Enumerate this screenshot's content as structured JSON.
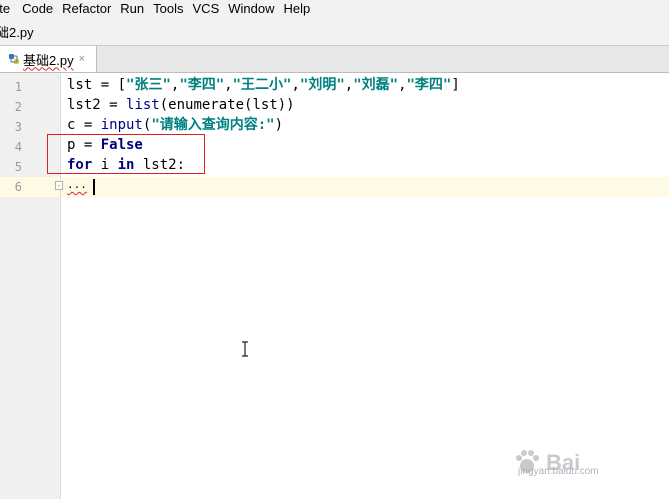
{
  "menu": {
    "items": [
      "ate",
      "Code",
      "Refactor",
      "Run",
      "Tools",
      "VCS",
      "Window",
      "Help"
    ]
  },
  "navbar": {
    "crumb": "础2.py"
  },
  "tab": {
    "label": "基础2.py",
    "close": "×"
  },
  "editor": {
    "line_numbers": [
      "1",
      "2",
      "3",
      "4",
      "5",
      "6"
    ],
    "lines": {
      "l1": {
        "a": "lst = [",
        "s1": "\"张三\"",
        "c1": ",",
        "s2": "\"李四\"",
        "c2": ",",
        "s3": "\"王二小\"",
        "c3": ",",
        "s4": "\"刘明\"",
        "c4": ",",
        "s5": "\"刘磊\"",
        "c5": ",",
        "s6": "\"李四\"",
        "b": "]"
      },
      "l2": {
        "a": "lst2 = ",
        "f1": "list",
        "p1": "(enumerate(lst))"
      },
      "l3": {
        "a": "c = ",
        "f": "input",
        "p1": "(",
        "s": "\"请输入查询内容:\"",
        "p2": ")"
      },
      "l4": {
        "a": "p = ",
        "kw": "False"
      },
      "l5": {
        "kw1": "for",
        "a": " i ",
        "kw2": "in",
        "b": " lst2:"
      },
      "l6": {
        "a": "..."
      }
    }
  },
  "watermark": {
    "text": "Bai",
    "sub": "jingyan.baidu.com"
  }
}
